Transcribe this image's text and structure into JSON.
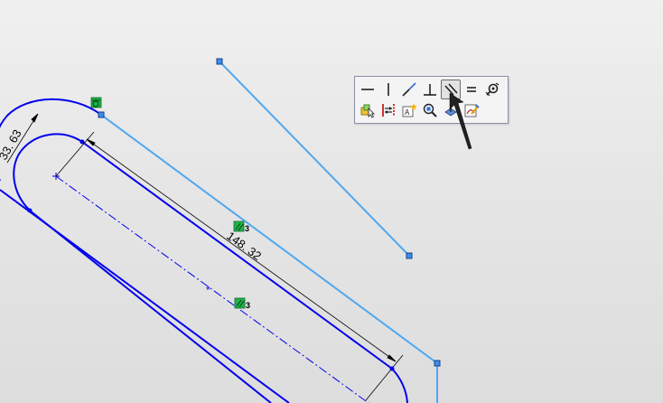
{
  "sketch": {
    "dimension_length": "148. 32",
    "dimension_radius": "33. 63",
    "relation_count_upper": "3",
    "relation_count_lower": "3"
  },
  "context_toolbar": {
    "row1": [
      {
        "icon": "horizontal-relation-icon",
        "name": "Horizontal"
      },
      {
        "icon": "vertical-relation-icon",
        "name": "Vertical"
      },
      {
        "icon": "collinear-relation-icon",
        "name": "Collinear"
      },
      {
        "icon": "perpendicular-relation-icon",
        "name": "Perpendicular"
      },
      {
        "icon": "parallel-relation-icon",
        "name": "Parallel",
        "pressed": true
      },
      {
        "icon": "equal-relation-icon",
        "name": "Equal"
      },
      {
        "icon": "fix-relation-icon",
        "name": "Fix"
      }
    ],
    "row2": [
      {
        "icon": "select-other-icon",
        "name": "Select Other"
      },
      {
        "icon": "construction-geometry-icon",
        "name": "Construction Geometry"
      },
      {
        "icon": "smart-dimension-icon",
        "name": "Smart Dimension"
      },
      {
        "icon": "zoom-selection-icon",
        "name": "Zoom to Selection"
      },
      {
        "icon": "normal-to-icon",
        "name": "Normal To"
      },
      {
        "icon": "edit-sketch-icon",
        "name": "Edit Sketch"
      }
    ]
  },
  "colors": {
    "sketch_blue": "#0000ee",
    "selected_line": "#4fa8f0",
    "endpoint_fill": "#3a8fe8",
    "relation_green": "#22b24c"
  }
}
